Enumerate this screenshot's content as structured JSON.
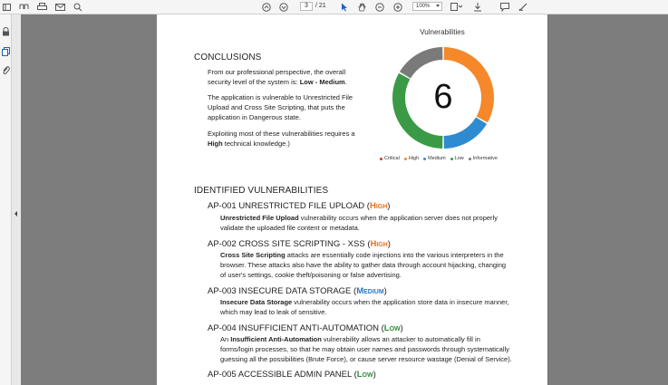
{
  "toolbar": {
    "page_current": "3",
    "page_total": "/ 21",
    "zoom": "100%"
  },
  "document": {
    "conclusions": {
      "heading": "CONCLUSIONS",
      "p1_a": "From our professional perspective, the overall",
      "p1_b": "security level of the system is: ",
      "p1_bold": "Low - Medium",
      "p1_end": ".",
      "p2_a": "The application is vulnerable to Unrestricted File",
      "p2_b": "Upload and Cross Site Scripting, that puts the",
      "p2_c": "application in Dangerous state.",
      "p3_a": "Exploiting most of these vulnerabilities requires a",
      "p3_bold": "High",
      "p3_b": " technical knowledge.)"
    },
    "identified": {
      "heading": "IDENTIFIED VULNERABILITIES",
      "items": [
        {
          "title": "AP-001 UNRESTRICTED FILE UPLOAD (",
          "severity": "High",
          "close": ")",
          "bold": "Unrestricted File Upload",
          "l1": " vulnerability occurs when the application server does not properly",
          "l2": "validate the uploaded file content or metadata."
        },
        {
          "title": "AP-002 CROSS SITE SCRIPTING - XSS (",
          "severity": "High",
          "close": ")",
          "bold": "Cross Site Scripting",
          "l1": " attacks are essentially code injections into the various interpreters in the",
          "l2": "browser. These attacks also have the ability to gather data through account hijacking, changing",
          "l3": "of user's settings, cookie theft/poisoning or false advertising."
        },
        {
          "title": "AP-003 INSECURE DATA STORAGE (",
          "severity": "Medium",
          "close": ")",
          "bold": "Insecure Data Storage",
          "l1": " vulnerability occurs when the application store data in insecure manner,",
          "l2": "which may lead to leak of sensitive."
        },
        {
          "title": "AP-004 INSUFFICIENT ANTI-AUTOMATION (",
          "severity": "Low",
          "close": ")",
          "pre": "An ",
          "bold": "Insufficient Anti-Automation",
          "l1": " vulnerability allows an attacker to automatically fill in",
          "l2": "forms/login processes, so that he may obtain user names and passwords through systematically",
          "l3": "guessing all the possibilities (Brute Force), or cause server resource wastage (Denial of Service)."
        },
        {
          "title": "AP-005 ACCESSIBLE ADMIN PANEL (",
          "severity": "Low",
          "close": ")"
        }
      ]
    }
  },
  "chart_data": {
    "type": "pie",
    "title": "Vulnerabilities",
    "center_value": "6",
    "categories": [
      "Critical",
      "High",
      "Medium",
      "Low",
      "Informative"
    ],
    "values": [
      0,
      2,
      1,
      2,
      1
    ],
    "colors": [
      "#d9342b",
      "#f5882a",
      "#2f8bd1",
      "#3a9a45",
      "#7a7a7a"
    ]
  },
  "colors": {
    "high": "#e8711a",
    "medium": "#2f78c2",
    "low": "#2f8a3a",
    "background": "#7d7d7d"
  },
  "icons": [
    "sidebar-toggle-icon",
    "bookmark-icon",
    "print-icon",
    "email-icon",
    "search-icon",
    "page-up-icon",
    "page-down-icon",
    "cursor-icon",
    "hand-icon",
    "zoom-out-icon",
    "zoom-in-icon",
    "fit-page-icon",
    "download-icon",
    "comment-icon",
    "draw-icon",
    "lock-icon",
    "copy-pages-icon",
    "attachment-icon"
  ]
}
